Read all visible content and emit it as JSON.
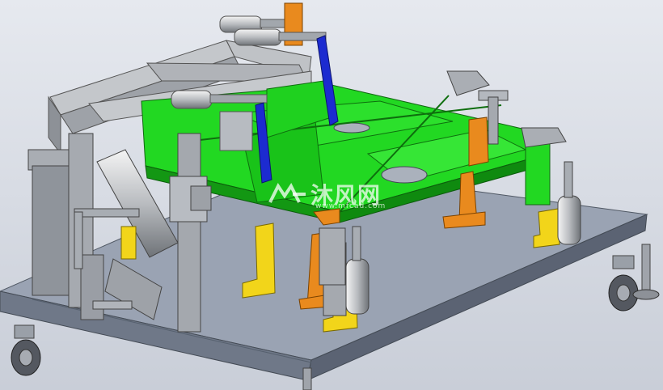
{
  "watermark": {
    "brand_text": "沐风网",
    "url_text": "www.mfcad.com"
  },
  "colors": {
    "background": "#d7dbe3",
    "base_plate": "#8d96a6",
    "frame_green": "#1fdc1f",
    "gray_steel": "#b4b8be",
    "orange_support": "#e98a1e",
    "yellow_block": "#f2d51a",
    "blue_arm": "#1c2bd0"
  },
  "icons": [
    "mfcad-logo-icon"
  ]
}
